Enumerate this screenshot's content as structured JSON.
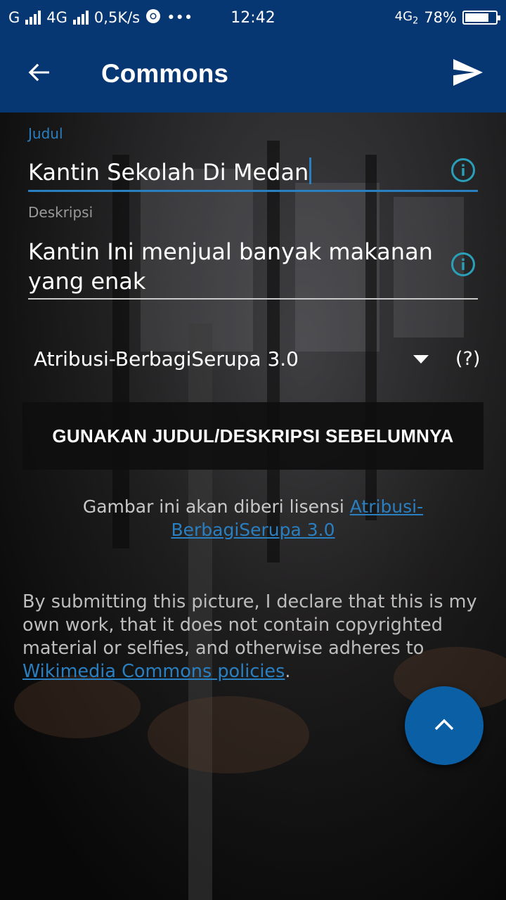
{
  "status_bar": {
    "carrier1": "G",
    "carrier2": "4G",
    "speed": "0,5K/s",
    "more": "•••",
    "time": "12:42",
    "network": "4G",
    "sim": "2",
    "battery": "78%",
    "battery_level": 0.78
  },
  "app_bar": {
    "back_icon": "arrow-back-icon",
    "title": "Commons",
    "send_icon": "send-icon"
  },
  "form": {
    "title_label": "Judul",
    "title_value": "Kantin Sekolah Di Medan",
    "description_label": "Deskripsi",
    "description_value": "Kantin Ini menjual banyak makanan yang enak",
    "info_icon": "info-icon",
    "license_value": "Atribusi-BerbagiSerupa 3.0",
    "license_help": "(?)",
    "previous_button": "GUNAKAN JUDUL/DESKRIPSI SEBELUMNYA"
  },
  "license_note": {
    "text": "Gambar ini akan diberi lisensi",
    "link": "Atribusi-BerbagiSerupa 3.0"
  },
  "declaration": {
    "text": "By submitting this picture, I declare that this is my own work, that it does not contain copyrighted material or selfies, and otherwise adheres to",
    "link": "Wikimedia Commons policies",
    "end": "."
  },
  "fab": {
    "icon": "chevron-up-icon"
  },
  "colors": {
    "primary": "#063772",
    "accent": "#2a7fc1",
    "fab": "#0b5fa5"
  }
}
